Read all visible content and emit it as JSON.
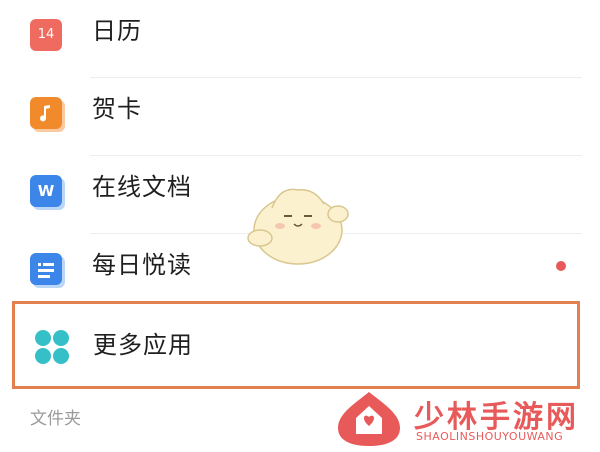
{
  "items": [
    {
      "label": "日历",
      "icon": "calendar-icon",
      "icon_text": "14",
      "color": "#ef6a5f"
    },
    {
      "label": "贺卡",
      "icon": "music-card-icon",
      "color": "#f08a2b"
    },
    {
      "label": "在线文档",
      "icon": "word-doc-icon",
      "icon_text": "W",
      "color": "#3b86e8"
    },
    {
      "label": "每日悦读",
      "icon": "reading-doc-icon",
      "color": "#3b86e8",
      "unread_dot": true
    }
  ],
  "highlighted_item": {
    "label": "更多应用",
    "icon": "more-apps-icon",
    "color": "#35c0c8",
    "highlight_color": "#e3804f"
  },
  "section_label": "文件夹",
  "watermark": {
    "title": "少林手游网",
    "subtitle": "SHAOLINSHOUYOUWANG",
    "color": "#e85a5a"
  }
}
